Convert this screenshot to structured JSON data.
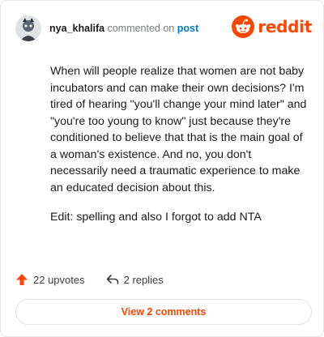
{
  "comment": {
    "username": "nya_khalifa",
    "action": "commented on",
    "post_link": "post",
    "paragraphs": [
      "When will people realize that women are not baby incubators and can make their own decisions? I'm tired of hearing \"you'll change your mind later\" and \"you're too young to know\" just because they're conditioned to believe that that is the main goal of a woman's existence. And no, you don't necessarily need a traumatic experience to make an educated decision about this.",
      "Edit: spelling and also I forgot to add NTA"
    ]
  },
  "logo": {
    "word": "reddit",
    "icon": "reddit-alien-icon"
  },
  "footer": {
    "upvotes": "22 upvotes",
    "replies": "2 replies",
    "upvote_icon": "upvote-arrow-icon",
    "reply_icon": "reply-arrow-icon"
  },
  "view_comments_label": "View 2 comments",
  "colors": {
    "brand": "#ff4500",
    "link": "#0079d3",
    "muted": "#787c7e"
  }
}
